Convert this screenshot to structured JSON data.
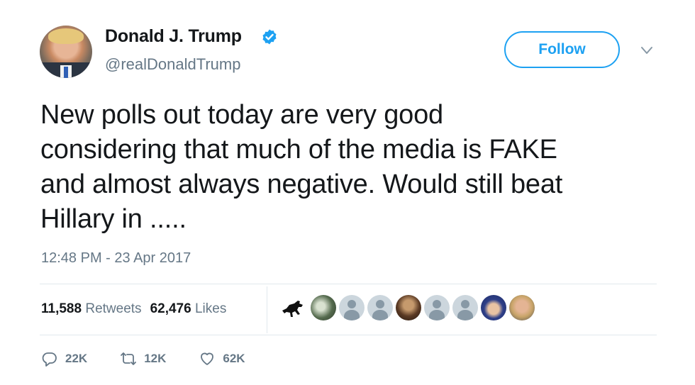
{
  "user": {
    "name": "Donald J. Trump",
    "handle": "@realDonaldTrump",
    "verified": true
  },
  "follow_button": {
    "label": "Follow"
  },
  "tweet": {
    "text": "New polls out today are very good\nconsidering that much of the media is FAKE\nand almost always negative. Would still beat\nHillary in .....",
    "timestamp": "12:48 PM - 23 Apr 2017"
  },
  "stats": {
    "retweets_count": "11,588",
    "retweets_label": "Retweets",
    "likes_count": "62,476",
    "likes_label": "Likes"
  },
  "liker_avatars": [
    "horse-avatar",
    "photo-avatar",
    "default-avatar",
    "default-avatar",
    "photo-avatar",
    "default-avatar",
    "default-avatar",
    "photo-avatar",
    "photo-avatar"
  ],
  "actions": {
    "reply_count": "22K",
    "retweet_count": "12K",
    "like_count": "62K"
  },
  "colors": {
    "accent": "#1da1f2",
    "text": "#14171a",
    "secondary": "#657786",
    "divider": "#e1e8ed"
  }
}
